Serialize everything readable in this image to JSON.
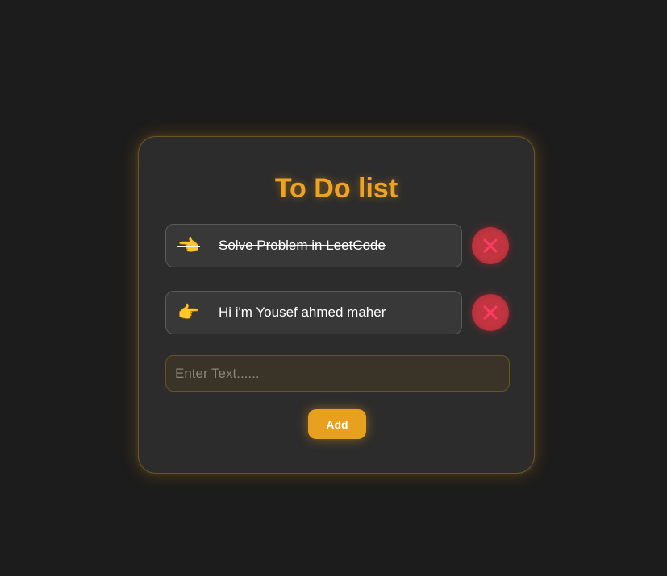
{
  "app": {
    "title": "To Do list"
  },
  "tasks": [
    {
      "icon": "👈",
      "text": "Solve Problem in LeetCode",
      "completed": true
    },
    {
      "icon": "👉",
      "text": "Hi i'm Yousef ahmed maher",
      "completed": false
    }
  ],
  "input": {
    "value": "",
    "placeholder": "Enter Text......"
  },
  "add_button": {
    "label": "Add"
  },
  "colors": {
    "accent": "#f0a221",
    "background": "#1c1c1c",
    "card": "#2c2c2c",
    "delete": "#c0353f",
    "delete_icon": "#ff3b63"
  },
  "icons": {
    "completed_task": "pointing-left-icon",
    "active_task": "pointing-right-icon",
    "delete": "close-icon"
  }
}
